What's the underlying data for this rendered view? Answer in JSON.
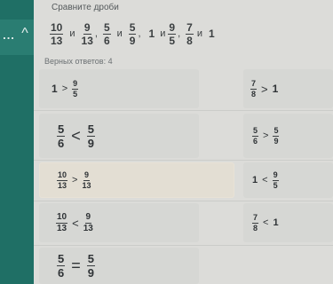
{
  "sidebar": {
    "dots": "...",
    "chevron": "^"
  },
  "title": "Сравните дроби",
  "task": {
    "f1": {
      "n": "10",
      "d": "13"
    },
    "and1": "и",
    "f2": {
      "n": "9",
      "d": "13"
    },
    "comma": ",",
    "f3": {
      "n": "5",
      "d": "6"
    },
    "and2": "и",
    "f4": {
      "n": "5",
      "d": "9"
    },
    "one1": "1",
    "and3": "и",
    "f5": {
      "n": "9",
      "d": "5"
    },
    "f6": {
      "n": "7",
      "d": "8"
    },
    "and4": "и",
    "one2": "1"
  },
  "score_label": "Верных ответов: 4",
  "answers": {
    "a1": {
      "left": "1",
      "op": ">",
      "fn": "9",
      "fd": "5"
    },
    "a2": {
      "fn": "7",
      "fd": "8",
      "op": ">",
      "right": "1"
    },
    "a3": {
      "n1": "5",
      "d1": "6",
      "op": "<",
      "n2": "5",
      "d2": "9"
    },
    "a4": {
      "n1": "5",
      "d1": "6",
      "op": ">",
      "n2": "5",
      "d2": "9"
    },
    "a5": {
      "n1": "10",
      "d1": "13",
      "op": ">",
      "n2": "9",
      "d2": "13"
    },
    "a6": {
      "left": "1",
      "op": "<",
      "fn": "9",
      "fd": "5"
    },
    "a7": {
      "n1": "10",
      "d1": "13",
      "op": "<",
      "n2": "9",
      "d2": "13"
    },
    "a8": {
      "fn": "7",
      "fd": "8",
      "op": "<",
      "right": "1"
    },
    "a9": {
      "n1": "5",
      "d1": "6",
      "op": "=",
      "n2": "5",
      "d2": "9"
    }
  }
}
